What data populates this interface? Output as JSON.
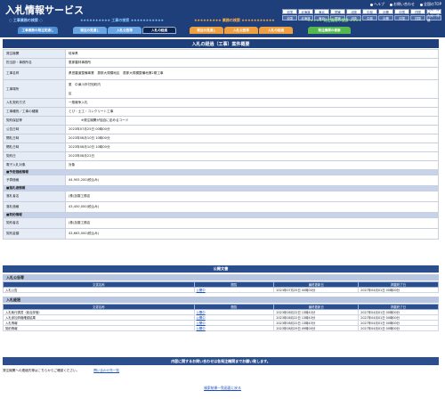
{
  "header": {
    "title": "入札情報サービス",
    "links": [
      "ヘルプ",
      "お問い合わせ",
      "全国のTOP"
    ],
    "cat_labels": [
      {
        "stars": "★★★★★★★★★★",
        "label": "工事の検索",
        "tail": "★★★★★★★★★★★",
        "color": "#7fc4ff"
      },
      {
        "stars": "★★★★★★★★★",
        "label": "業務の検索",
        "tail": "★★★★★★★★★★★",
        "color": "#ffae4d"
      },
      {
        "stars": "★★★★★",
        "label": "発注機関の検索",
        "tail": "★★★★",
        "color": "#8fe08a"
      }
    ],
    "left_label": "○ 工事業務の検索 ○",
    "prefs_row1": [
      "全国",
      "北海道",
      "東北",
      "関東",
      "北陸",
      "中部",
      "近畿",
      "中国",
      "四国",
      "九州・沖縄"
    ],
    "prefs_row2": [
      "全国",
      "北海道",
      "東北",
      "関東",
      "北陸",
      "中部",
      "近畿",
      "中国",
      "四国",
      "九州・沖縄"
    ]
  },
  "tabs": [
    {
      "label": "工事業務の発注見通し",
      "color": "#4f8fd6"
    },
    {
      "label": "発注の見通し",
      "color": "#6aa6e4"
    },
    {
      "label": "入札公告等",
      "color": "#6aa6e4"
    },
    {
      "label": "入札の経過",
      "color": "#0c2550"
    },
    {
      "label": "発注の見通し",
      "color": "#f0a040"
    },
    {
      "label": "入札公告等",
      "color": "#f0a040"
    },
    {
      "label": "入札の経過",
      "color": "#f0a040"
    },
    {
      "label": "発注機関の検索",
      "color": "#55b84f"
    }
  ],
  "section_title": "入札の経過（工事）案件概要",
  "detail": {
    "orderer_label": "発注機関",
    "orderer": "岐阜県",
    "dept_label": "担当部・事務所名",
    "dept": "恵那農林事務所",
    "work_name_label": "工事名称",
    "work_name": "県営農道整備事業　恵那大規模地区　恵那大規模整備地第2期工事",
    "place_label": "工事場所",
    "place1": "恵　中津川市付知町内",
    "place2": "区",
    "method_label": "入札契約方式",
    "method": "一般競争入札",
    "type_label": "工事種別／工事の種類",
    "type": "とび・土工・コンクリート工事",
    "bond_label": "契約保証等",
    "bond": "※発注機関が独自に定めるコード",
    "pub_date_label": "公告日時",
    "pub_date": "2023年07月25日 00時00分",
    "open_date_label": "開札日時",
    "open_date": "2023年08月10日 10時00分",
    "result_date_label": "開札日時",
    "result_date": "2023年08月10日 10時00分",
    "contract_date_label": "契約日",
    "contract_date": "2023年08月22日",
    "e_bid_label": "電子入札対象",
    "e_bid": "対象",
    "planned_section": "■予定価格情報",
    "planned_price_label": "予算価格",
    "planned_price": "44,905,200(税込み)",
    "winner_section": "■落札者情報",
    "winner_name_label": "落札者名",
    "winner_name": "(株)加藤工務店",
    "winner_price_label": "落札価格",
    "winner_price": "43,450,000(税込み)",
    "contract_section": "■契約情報",
    "contract_name_label": "契約者名",
    "contract_name": "(株)加藤工務店",
    "contract_amount_label": "契約金額",
    "contract_amount": "43,663,000(税込み)"
  },
  "docs": {
    "title": "公開文書",
    "sec1": "入札公告等",
    "sec2": "入札経過",
    "headers": [
      "文書名称",
      "閲覧",
      "最終更新日",
      "掲載終了日"
    ],
    "rows1": [
      {
        "name": "入札公告",
        "view": "公開中",
        "updated": "2023年07月25日 00時00分",
        "end": "2027年04月01日 00時00分"
      }
    ],
    "rows2": [
      {
        "name": "入札執行調書（総合評価）",
        "view": "公開中",
        "updated": "2023年08月22日 13時43分",
        "end": "2027年04月01日 00時00分"
      },
      {
        "name": "入札参加資格確認結果",
        "view": "公開中",
        "updated": "2023年08月22日 13時43分",
        "end": "2027年04月01日 00時00分"
      },
      {
        "name": "入札情報",
        "view": "公開中",
        "updated": "2023年08月22日 13時43分",
        "end": "2027年04月01日 00時00分"
      },
      {
        "name": "契約情報",
        "view": "公開中",
        "updated": "2023年08月29日 09時00分",
        "end": "2027年04月01日 00時00分"
      }
    ]
  },
  "notice": "内容に関するお問い合わせは各発注機関までお願い致します。",
  "contact_text": "発注機関への連絡先等はこちらからご確認ください。",
  "contact_link": "問い合わせ先一覧",
  "back_link": "検索結果一覧画面に戻る"
}
